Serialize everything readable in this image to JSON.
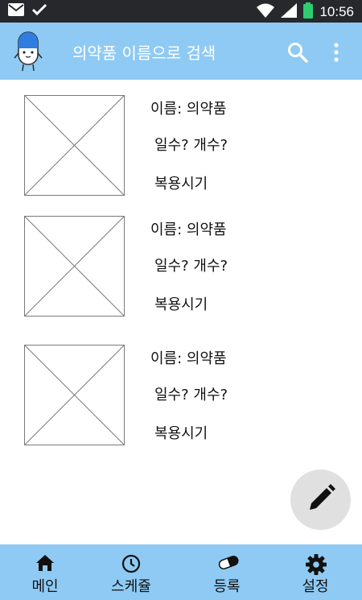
{
  "status_bar": {
    "time": "10:56",
    "icons": [
      "mail-icon",
      "check-icon",
      "wifi-icon",
      "signal-icon",
      "battery-icon"
    ],
    "battery_color": "#2ecc71"
  },
  "app_bar": {
    "title": "의약품 이름으로 검색",
    "background": "#8ecaf3",
    "icons": [
      "pill-mascot-icon",
      "search-icon",
      "more-vert-icon"
    ]
  },
  "items": [
    {
      "name": "이름: 의약품",
      "count": "일수? 개수?",
      "timing": "복용시기"
    },
    {
      "name": "이름: 의약품",
      "count": "일수? 개수?",
      "timing": "복용시기"
    },
    {
      "name": "이름: 의약품",
      "count": "일수? 개수?",
      "timing": "복용시기"
    }
  ],
  "fab": {
    "icon": "pencil-icon"
  },
  "bottom_nav": {
    "items": [
      {
        "label": "메인",
        "icon": "home-icon"
      },
      {
        "label": "스케쥴",
        "icon": "clock-icon"
      },
      {
        "label": "등록",
        "icon": "pill-icon"
      },
      {
        "label": "설정",
        "icon": "gear-icon"
      }
    ]
  }
}
